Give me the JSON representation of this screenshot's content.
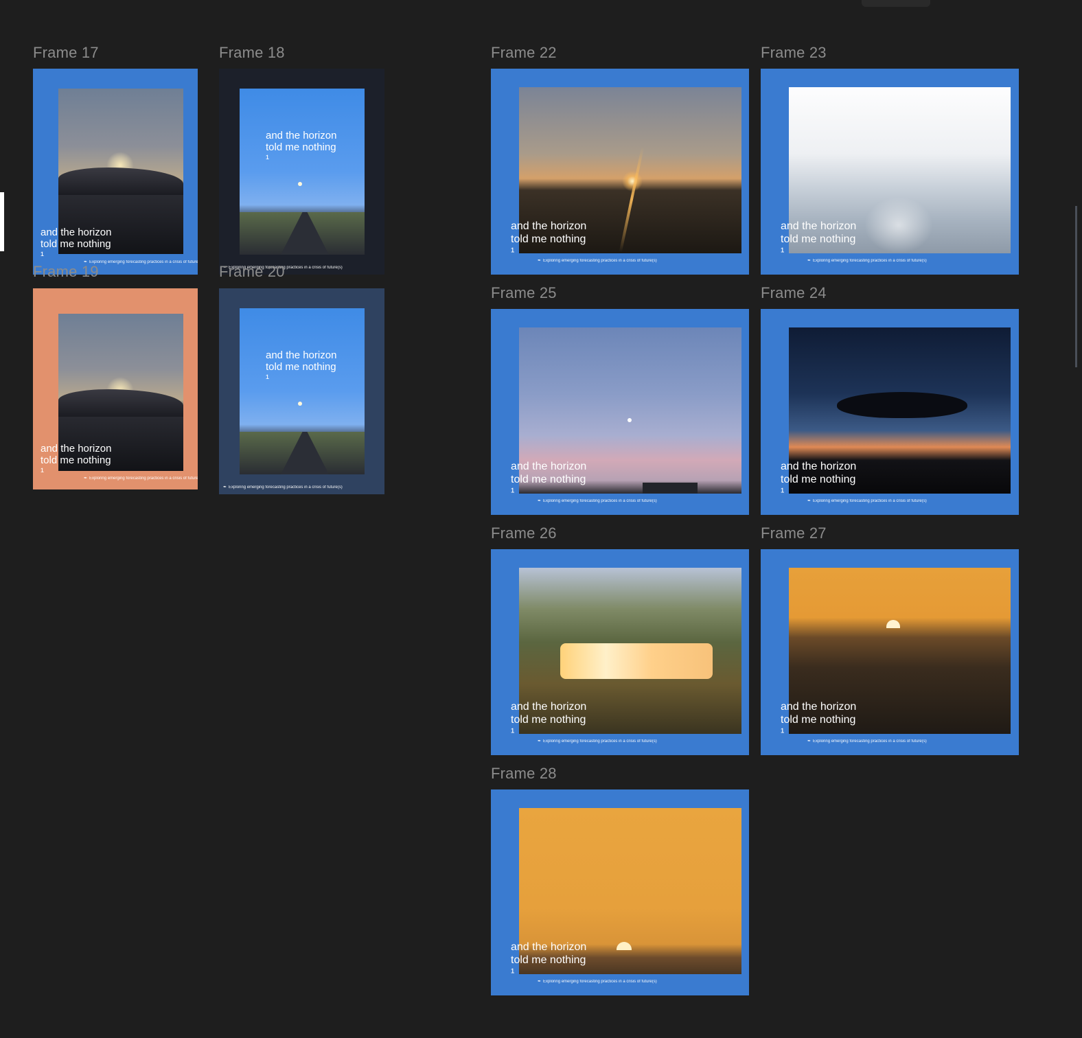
{
  "canvas": {
    "background": "#1e1e1e",
    "label_color": "#8c8c8c"
  },
  "caption": {
    "line1": "and the horizon",
    "line2": "told me nothing",
    "marker": "¹"
  },
  "footnote": {
    "icon": "pen-icon",
    "text": "Exploring emerging forecasting practices in a crisis of future(s)"
  },
  "frames": {
    "f17": {
      "label": "Frame 17",
      "bg": "#3a7bd0"
    },
    "f18": {
      "label": "Frame 18",
      "bg": "#1c202a"
    },
    "f19": {
      "label": "Frame 19",
      "bg": "#e2916d"
    },
    "f20": {
      "label": "Frame 20",
      "bg": "#2f4260"
    },
    "f22": {
      "label": "Frame 22",
      "bg": "#3a7bd0"
    },
    "f23": {
      "label": "Frame 23",
      "bg": "#3a7bd0"
    },
    "f25": {
      "label": "Frame 25",
      "bg": "#3a7bd0"
    },
    "f24": {
      "label": "Frame 24",
      "bg": "#3a7bd0"
    },
    "f26": {
      "label": "Frame 26",
      "bg": "#3a7bd0"
    },
    "f27": {
      "label": "Frame 27",
      "bg": "#3a7bd0"
    },
    "f28": {
      "label": "Frame 28",
      "bg": "#3a7bd0"
    }
  }
}
